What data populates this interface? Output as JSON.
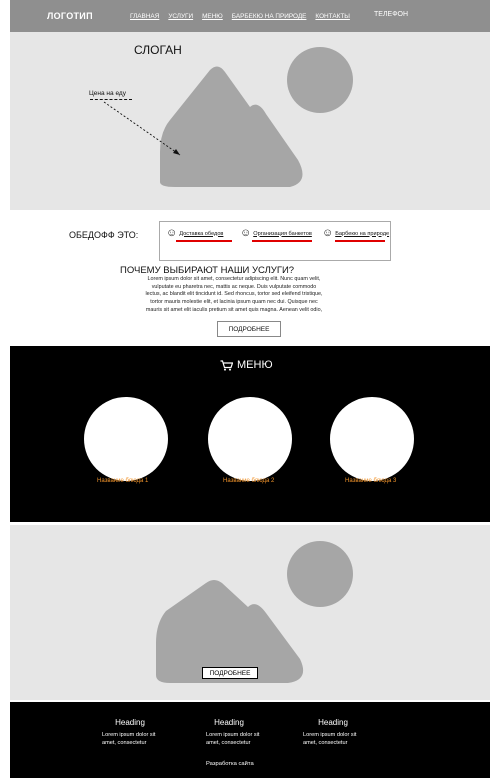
{
  "header": {
    "logo": "ЛОГОТИП",
    "nav": [
      "ГЛАВНАЯ",
      "УСЛУГИ",
      "МЕНЮ",
      "БАРБЕКЮ НА ПРИРОДЕ",
      "КОНТАКТЫ"
    ],
    "phone": "ТЕЛЕФОН"
  },
  "hero": {
    "slogan": "СЛОГАН",
    "price_label": "Цена на еду",
    "image_icon": "image-placeholder-icon"
  },
  "about": {
    "title": "ОБЕДОФФ ЭТО:",
    "services": [
      {
        "icon": "smiley-icon",
        "label": "Доставка обедов"
      },
      {
        "icon": "smiley-icon",
        "label": "Организация банкетов"
      },
      {
        "icon": "smiley-icon",
        "label": "Барбекю на природе"
      }
    ],
    "why_title": "ПОЧЕМУ ВЫБИРАЮТ НАШИ УСЛУГИ?",
    "lorem_lines": [
      "Lorem ipsum dolor sit amet, consectetur adipiscing elit. Nunc quam velit,",
      "vulputate eu pharetra nec, mattis ac neque. Duis vulputate commodo",
      "lectus, ac blandit elit tincidunt id. Sed rhoncus, tortor sed eleifend tristique,",
      "tortor mauris molestie elit, et lacinia ipsum quam nec dui. Quisque nec",
      "mauris sit amet elit iaculis pretium sit amet quis magna. Aenean velit odio,"
    ],
    "more_button": "ПОДРОБНЕЕ"
  },
  "menu": {
    "icon": "cart-icon",
    "title": "МЕНЮ",
    "dishes": [
      "Название блюда 1",
      "Название блюда 2",
      "Название блюда 3"
    ]
  },
  "promo": {
    "image_icon": "image-placeholder-icon",
    "more_button": "ПОДРОБНЕЕ"
  },
  "footer": {
    "columns": [
      {
        "heading": "Heading",
        "line1": "Lorem ipsum dolor sit",
        "line2": "amet, consectetur"
      },
      {
        "heading": "Heading",
        "line1": "Lorem ipsum dolor sit",
        "line2": "amet, consectetur"
      },
      {
        "heading": "Heading",
        "line1": "Lorem ipsum dolor sit",
        "line2": "amet, consectetur"
      }
    ],
    "developer": "Разработка сайта"
  },
  "colors": {
    "header_bg": "#8f8f8f",
    "hero_bg": "#e6e6e6",
    "placeholder_gray": "#a6a6a6",
    "dish_name": "#f0932b",
    "accent_underline": "#e00000",
    "dark_bg": "#000000"
  }
}
